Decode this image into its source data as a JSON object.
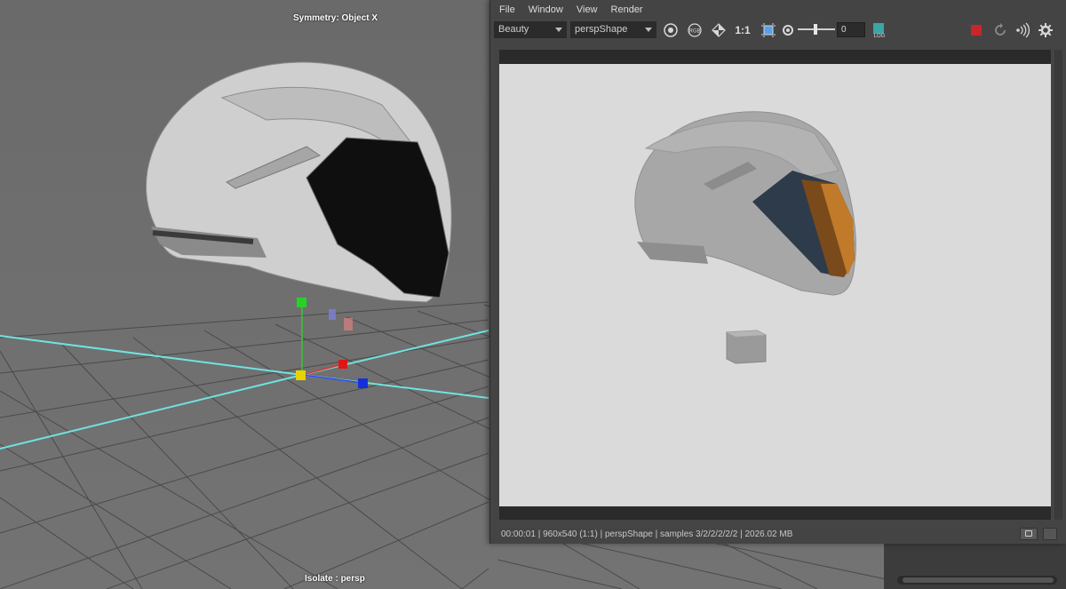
{
  "viewport": {
    "hud_top": "Symmetry: Object X",
    "hud_bottom": "Isolate : persp"
  },
  "render_view": {
    "menu": [
      "File",
      "Window",
      "View",
      "Render"
    ],
    "toolbar": {
      "pass_dropdown": "Beauty",
      "camera_dropdown": "perspShape",
      "icons": [
        "display-circle-icon",
        "rgb-channel-icon",
        "snapshot-region-icon"
      ],
      "ratio_label": "1:1",
      "exposure_value": "0",
      "log_icon": "log-icon",
      "right_icons": [
        "stop-render-icon",
        "refresh-render-icon",
        "ipr-icon",
        "gear-icon"
      ]
    },
    "status": "00:00:01 | 960x540 (1:1) | perspShape  | samples 3/2/2/2/2/2 | 2026.02 MB"
  },
  "colors": {
    "accent_stop": "#c8262a",
    "grid_axis": "#6fe3e0",
    "render_bg": "#dadada"
  }
}
